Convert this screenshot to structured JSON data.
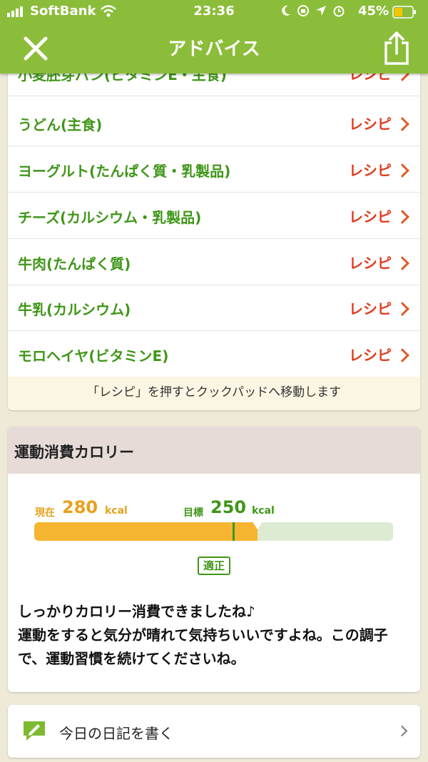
{
  "status_bar": {
    "carrier": "SoftBank",
    "time": "23:36",
    "battery": "45%"
  },
  "header": {
    "title": "アドバイス",
    "close_icon": "close-icon",
    "share_icon": "share-icon",
    "color": "#8bbd3a"
  },
  "foods": {
    "items": [
      {
        "name": "小麦胚芽パン(ビタミンE・主食)",
        "link": "レシピ"
      },
      {
        "name": "うどん(主食)",
        "link": "レシピ"
      },
      {
        "name": "ヨーグルト(たんぱく質・乳製品)",
        "link": "レシピ"
      },
      {
        "name": "チーズ(カルシウム・乳製品)",
        "link": "レシピ"
      },
      {
        "name": "牛肉(たんぱく質)",
        "link": "レシピ"
      },
      {
        "name": "牛乳(カルシウム)",
        "link": "レシピ"
      },
      {
        "name": "モロヘイヤ(ビタミンE)",
        "link": "レシピ"
      }
    ],
    "note": "「レシピ」を押すとクックパッドへ移動します"
  },
  "exercise": {
    "title": "運動消費カロリー",
    "current_label": "現在",
    "current_value": "280",
    "target_label": "目標",
    "target_value": "250",
    "unit": "kcal",
    "progress": {
      "current": 280,
      "target": 250,
      "max": 450
    },
    "badge": "適正",
    "message_line1": "しっかりカロリー消費できましたね♪",
    "message_line2": "運動をすると気分が晴れて気持ちいいですよね。この調子で、運動習慣を続けてくださいね。"
  },
  "diary": {
    "label": "今日の日記を書く",
    "icon": "edit-note-icon"
  }
}
